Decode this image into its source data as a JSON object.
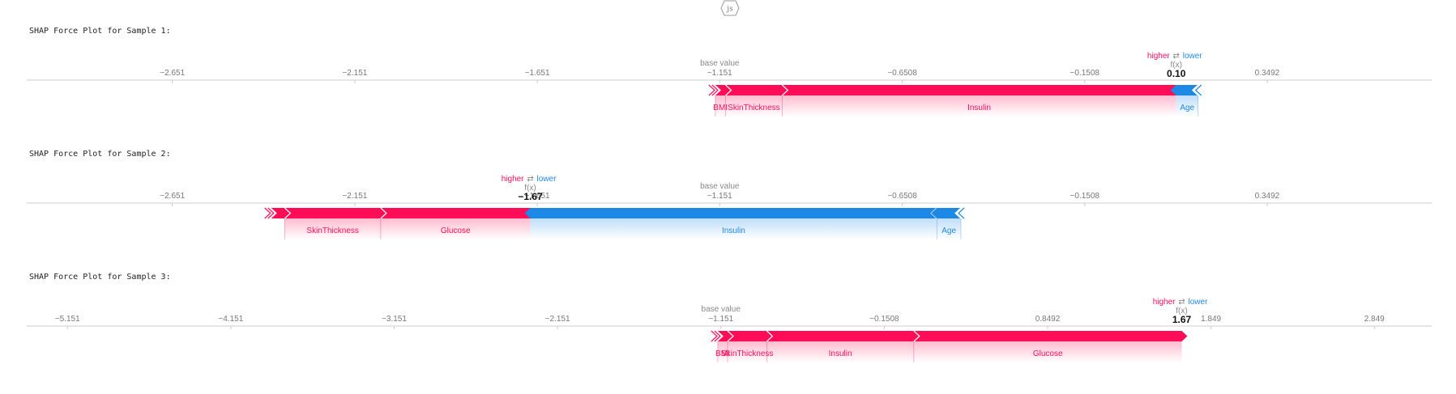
{
  "badge": "js",
  "colors": {
    "positive": "#ff0d57",
    "negative": "#1e88e5",
    "axis": "#cccccc",
    "text": "#222222"
  },
  "legend": {
    "higher": "higher",
    "arrows": "⇄",
    "lower": "lower"
  },
  "labels": {
    "base_value": "base value",
    "fx": "f(x)"
  },
  "samples": [
    {
      "title": "SHAP Force Plot for Sample 1:",
      "fx_text": "0.10"
    },
    {
      "title": "SHAP Force Plot for Sample 2:",
      "fx_text": "−1.67"
    },
    {
      "title": "SHAP Force Plot for Sample 3:",
      "fx_text": "1.67"
    }
  ],
  "chart_data": [
    {
      "type": "force",
      "xlim": [
        -3.05,
        0.8
      ],
      "ticks": [
        -2.651,
        -2.151,
        -1.651,
        -1.151,
        -0.6508,
        -0.1508,
        0.3492
      ],
      "tick_labels": [
        "−2.651",
        "−2.151",
        "−1.651",
        "−1.151",
        "−0.6508",
        "−0.1508",
        "0.3492"
      ],
      "base_value": -1.151,
      "fx": 0.1,
      "positive": [
        {
          "feature": "BMI",
          "start": -1.163,
          "end": -1.135
        },
        {
          "feature": "SkinThickness",
          "start": -1.135,
          "end": -0.98
        },
        {
          "feature": "Insulin",
          "start": -0.98,
          "end": 0.1
        }
      ],
      "negative": [
        {
          "feature": "Age",
          "start": 0.1,
          "end": 0.16
        }
      ]
    },
    {
      "type": "force",
      "xlim": [
        -3.05,
        0.8
      ],
      "ticks": [
        -2.651,
        -2.151,
        -1.651,
        -1.151,
        -0.6508,
        -0.1508,
        0.3492
      ],
      "tick_labels": [
        "−2.651",
        "−2.151",
        "−1.651",
        "−1.151",
        "−0.6508",
        "−0.1508",
        "0.3492"
      ],
      "base_value": -1.151,
      "fx": -1.67,
      "positive": [
        {
          "feature": "",
          "start": -2.38,
          "end": -2.343
        },
        {
          "feature": "SkinThickness",
          "start": -2.343,
          "end": -2.08
        },
        {
          "feature": "Glucose",
          "start": -2.08,
          "end": -1.67
        }
      ],
      "negative": [
        {
          "feature": "Insulin",
          "start": -1.67,
          "end": -0.556
        },
        {
          "feature": "Age",
          "start": -0.556,
          "end": -0.49
        }
      ]
    },
    {
      "type": "force",
      "xlim": [
        -5.4,
        3.2
      ],
      "ticks": [
        -5.151,
        -4.151,
        -3.151,
        -2.151,
        -1.151,
        -0.1508,
        0.8492,
        1.849,
        2.849
      ],
      "tick_labels": [
        "−5.151",
        "−4.151",
        "−3.151",
        "−2.151",
        "−1.151",
        "−0.1508",
        "0.8492",
        "1.849",
        "2.849"
      ],
      "base_value": -1.151,
      "fx": 1.67,
      "positive": [
        {
          "feature": "BMI",
          "start": -1.17,
          "end": -1.11
        },
        {
          "feature": "SkinThickness",
          "start": -1.11,
          "end": -0.87
        },
        {
          "feature": "Insulin",
          "start": -0.87,
          "end": 0.03
        },
        {
          "feature": "Glucose",
          "start": 0.03,
          "end": 1.67
        }
      ],
      "negative": []
    }
  ]
}
